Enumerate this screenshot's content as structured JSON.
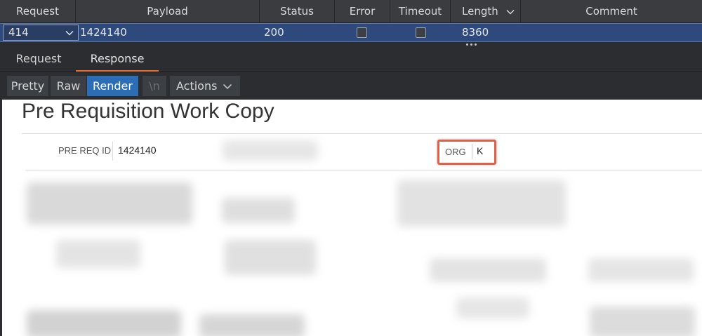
{
  "table": {
    "columns": [
      "Request",
      "Payload",
      "Status",
      "Error",
      "Timeout",
      "Length",
      "Comment"
    ],
    "sorted_column": "Length",
    "row": {
      "request": "414",
      "payload": "1424140",
      "status": "200",
      "error": false,
      "timeout": false,
      "length": "8360",
      "comment": ""
    }
  },
  "tabs": {
    "items": [
      "Request",
      "Response"
    ],
    "active": "Response"
  },
  "view_modes": {
    "items": [
      "Pretty",
      "Raw",
      "Render",
      "\\n",
      "Actions"
    ],
    "active": "Render"
  },
  "rendered_page": {
    "title": "Pre Requisition Work Copy",
    "fields": {
      "pre_req_id_label": "PRE REQ ID",
      "pre_req_id_value": "1424140",
      "org_label": "ORG",
      "org_value": "K"
    }
  },
  "colors": {
    "selected_row": "#2e4a7c",
    "active_tab_underline": "#e66a32",
    "active_view_button": "#2d6db5",
    "highlight_box": "#e0614a"
  },
  "icons": {
    "sort": "chevron-down-icon",
    "dropdown": "chevron-down-icon",
    "grip": "drag-handle-icon"
  }
}
